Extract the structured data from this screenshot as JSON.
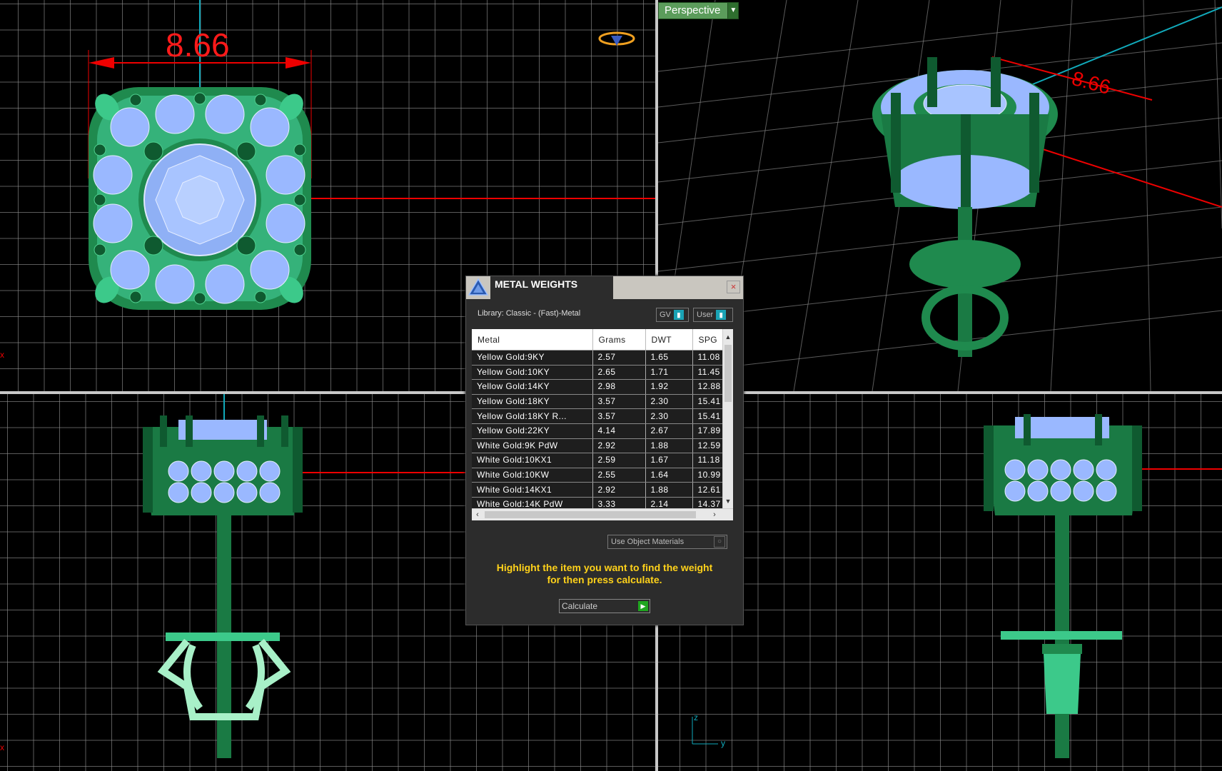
{
  "viewports": {
    "top": {
      "dimension_value": "8.66",
      "axis_mark": "x"
    },
    "perspective": {
      "label": "Perspective",
      "dimension_value": "8.66"
    },
    "front": {
      "axis_mark": "x"
    },
    "side": {
      "axis_z": "z",
      "axis_y": "y"
    }
  },
  "dialog": {
    "title": "METAL WEIGHTS",
    "close_label": "×",
    "library": "Library: Classic - (Fast)-Metal",
    "toggle_gv": "GV",
    "toggle_user": "User",
    "table": {
      "headers": {
        "metal": "Metal",
        "grams": "Grams",
        "dwt": "DWT",
        "spg": "SPG"
      },
      "rows": [
        {
          "metal": "Yellow Gold:9KY",
          "grams": "2.57",
          "dwt": "1.65",
          "spg": "11.08"
        },
        {
          "metal": "Yellow Gold:10KY",
          "grams": "2.65",
          "dwt": "1.71",
          "spg": "11.45"
        },
        {
          "metal": "Yellow Gold:14KY",
          "grams": "2.98",
          "dwt": "1.92",
          "spg": "12.88"
        },
        {
          "metal": "Yellow Gold:18KY",
          "grams": "3.57",
          "dwt": "2.30",
          "spg": "15.41"
        },
        {
          "metal": "Yellow Gold:18KY R...",
          "grams": "3.57",
          "dwt": "2.30",
          "spg": "15.41"
        },
        {
          "metal": "Yellow Gold:22KY",
          "grams": "4.14",
          "dwt": "2.67",
          "spg": "17.89"
        },
        {
          "metal": "White Gold:9K PdW",
          "grams": "2.92",
          "dwt": "1.88",
          "spg": "12.59"
        },
        {
          "metal": "White Gold:10KX1",
          "grams": "2.59",
          "dwt": "1.67",
          "spg": "11.18"
        },
        {
          "metal": "White Gold:10KW",
          "grams": "2.55",
          "dwt": "1.64",
          "spg": "10.99"
        },
        {
          "metal": "White Gold:14KX1",
          "grams": "2.92",
          "dwt": "1.88",
          "spg": "12.61"
        },
        {
          "metal": "White Gold:14K PdW",
          "grams": "3.33",
          "dwt": "2.14",
          "spg": "14.37"
        }
      ]
    },
    "use_object_materials": "Use Object Materials",
    "hint_line1": "Highlight the item you want to find the weight",
    "hint_line2": "for then press calculate.",
    "calculate_label": "Calculate"
  },
  "colors": {
    "metal": "#1f8a4e",
    "gem": "#9ab8ff",
    "dimension": "#ff1a1a",
    "hint": "#ffd21a",
    "grid": "#8c8c8c"
  }
}
